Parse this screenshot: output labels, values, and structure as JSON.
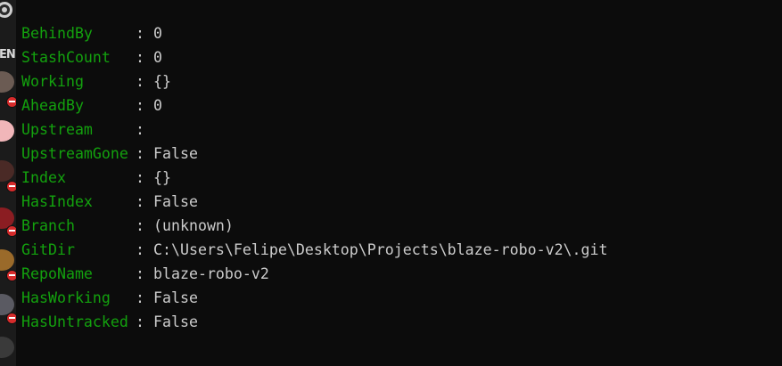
{
  "left_strip": {
    "partial_label": "EN",
    "items": [
      {
        "icon": "avatar-dark-icon",
        "color": "#6b5b53",
        "badge": true
      },
      {
        "icon": "avatar-pink-icon",
        "color": "#f1b6b9",
        "badge": false
      },
      {
        "icon": "avatar-hair-icon",
        "color": "#4a2a26",
        "badge": true
      },
      {
        "icon": "avatar-red-icon",
        "color": "#8b1d22",
        "badge": true
      },
      {
        "icon": "avatar-gold-icon",
        "color": "#9a6a2a",
        "badge": true
      },
      {
        "icon": "avatar-gray-icon",
        "color": "#5a5a62",
        "badge": true
      },
      {
        "icon": "avatar-dark2-icon",
        "color": "#3a3a3a",
        "badge": false
      }
    ]
  },
  "terminal": {
    "separator": ":",
    "rows": [
      {
        "key": "BehindBy",
        "value": "0"
      },
      {
        "key": "StashCount",
        "value": "0"
      },
      {
        "key": "Working",
        "value": "{}"
      },
      {
        "key": "AheadBy",
        "value": "0"
      },
      {
        "key": "Upstream",
        "value": ""
      },
      {
        "key": "UpstreamGone",
        "value": "False"
      },
      {
        "key": "Index",
        "value": "{}"
      },
      {
        "key": "HasIndex",
        "value": "False"
      },
      {
        "key": "Branch",
        "value": "(unknown)"
      },
      {
        "key": "GitDir",
        "value": "C:\\Users\\Felipe\\Desktop\\Projects\\blaze-robo-v2\\.git"
      },
      {
        "key": "RepoName",
        "value": "blaze-robo-v2"
      },
      {
        "key": "HasWorking",
        "value": "False"
      },
      {
        "key": "HasUntracked",
        "value": "False"
      }
    ]
  },
  "colors": {
    "background": "#0c0c0c",
    "key_color": "#13a10e",
    "value_color": "#cccccc"
  }
}
